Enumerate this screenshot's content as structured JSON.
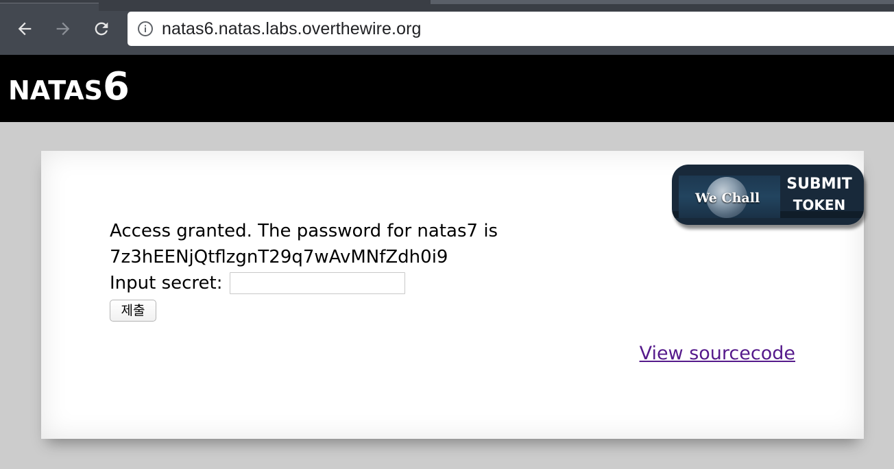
{
  "browser": {
    "url": "natas6.natas.labs.overthewire.org",
    "back_icon": "arrow-left-icon",
    "forward_icon": "arrow-right-icon",
    "reload_icon": "reload-icon",
    "info_icon": "info-icon"
  },
  "header": {
    "title_word": "NATAS",
    "title_number": "6"
  },
  "content": {
    "message_line1": "Access granted. The password for natas7 is",
    "password": "7z3hEENjQtflzgnT29q7wAvMNfZdh0i9",
    "input_label": "Input secret:",
    "input_value": "",
    "submit_label": "제출",
    "view_source_label": "View sourcecode"
  },
  "badge": {
    "logo_text": "We Chall",
    "line1": "SUBMIT",
    "line2": "TOKEN"
  },
  "colors": {
    "chrome_bg": "#434850",
    "header_bg": "#000000",
    "page_bg": "#cccccc",
    "link_visited": "#551a8b",
    "badge_bg": "#18293a"
  }
}
